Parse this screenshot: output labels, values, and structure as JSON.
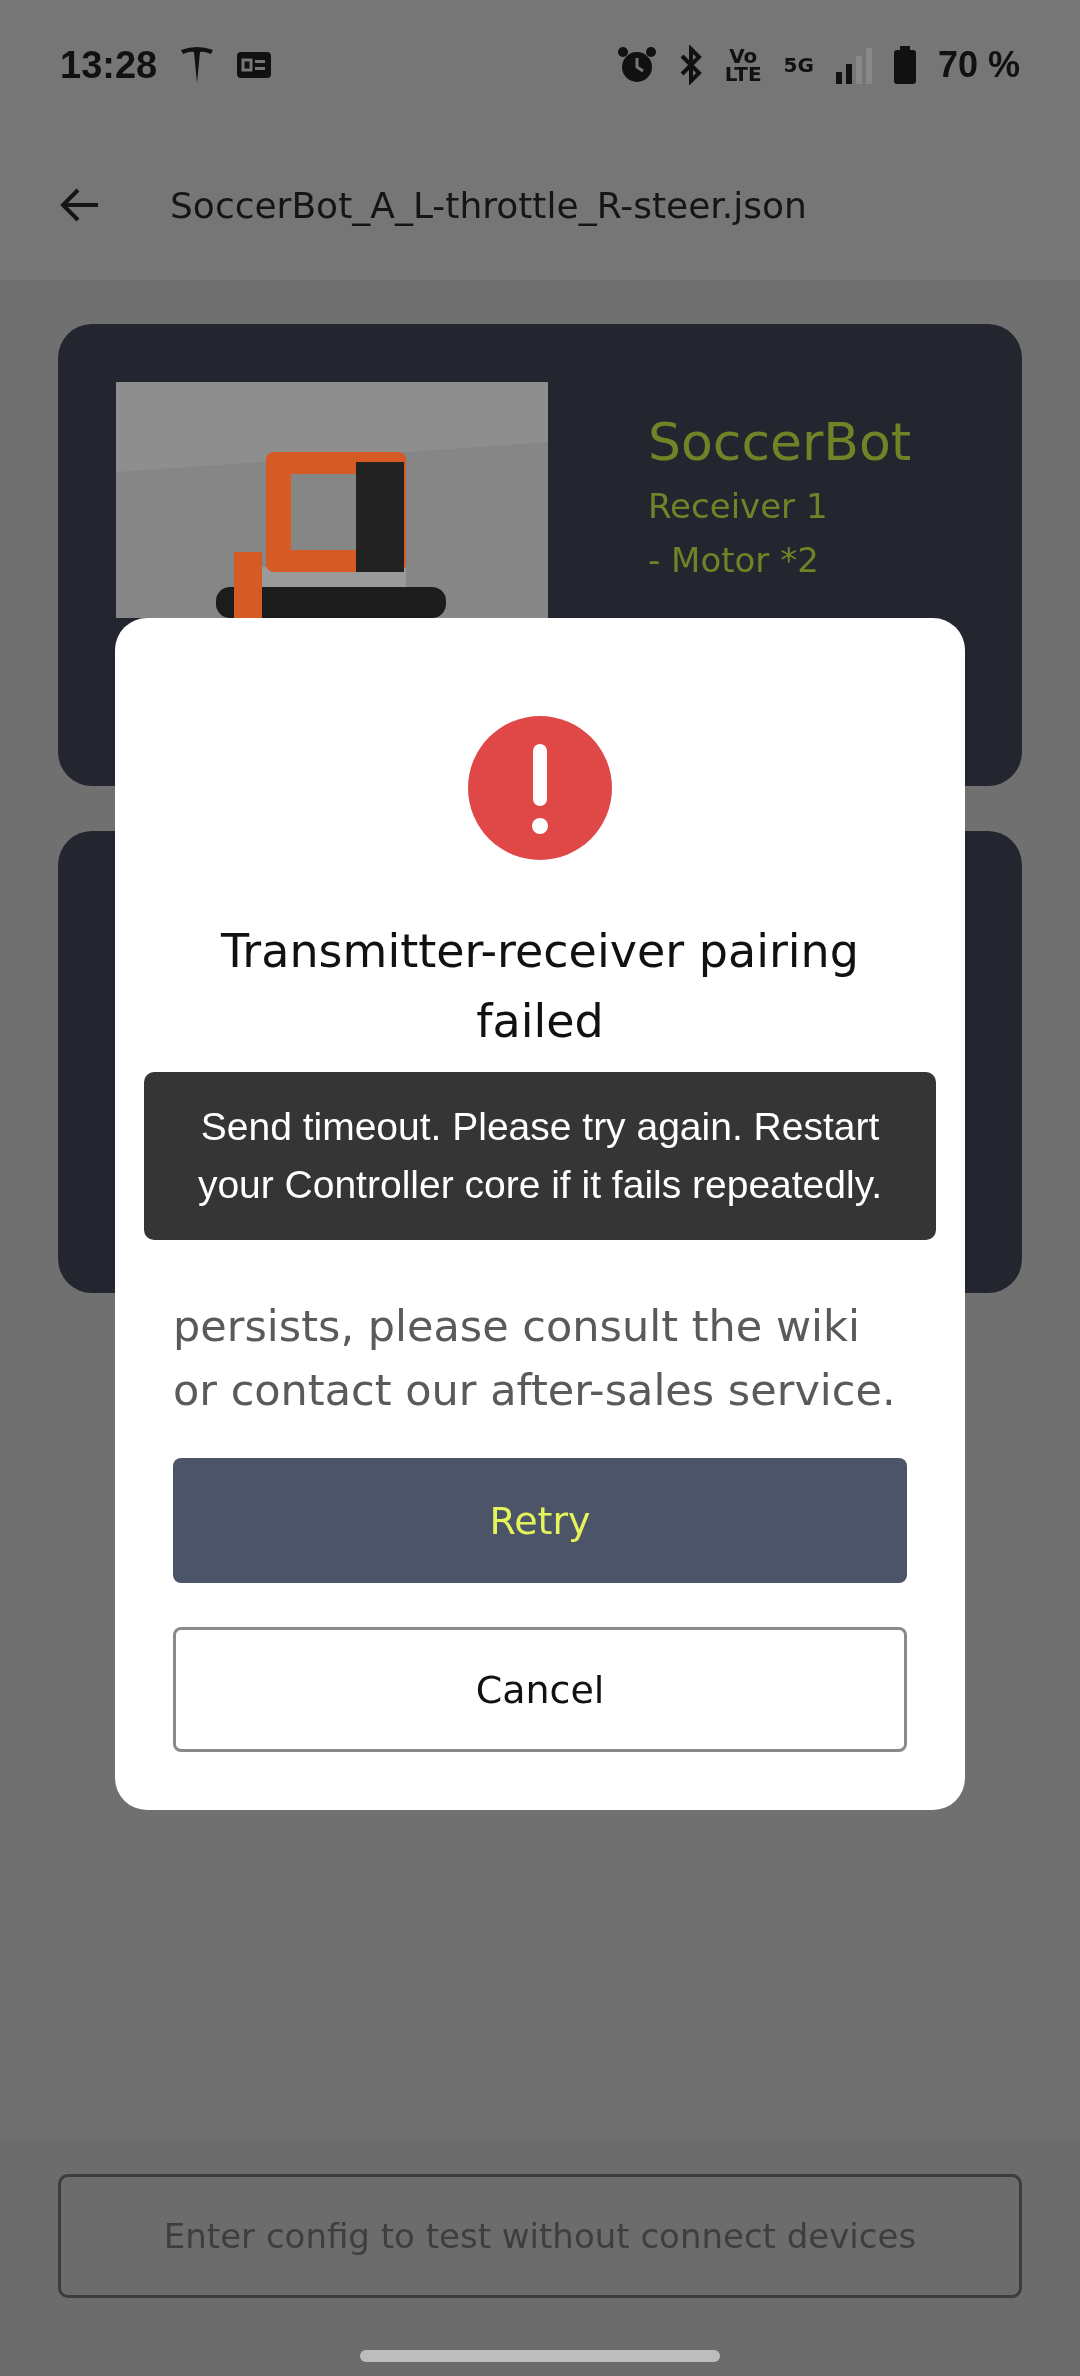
{
  "status_bar": {
    "time": "13:28",
    "volte_top": "Vo",
    "volte_bottom": "LTE",
    "network": "5G",
    "battery": "70 %"
  },
  "app_bar": {
    "title": "SoccerBot_A_L-throttle_R-steer.json"
  },
  "cards": [
    {
      "kind": "robot",
      "name": "SoccerBot",
      "receiver": "Receiver 1",
      "parts": [
        "- Motor *2"
      ]
    },
    {
      "kind": "empty"
    }
  ],
  "dialog": {
    "title": "Transmitter-receiver pairing failed",
    "message": "persists, please consult the wiki or contact our after-sales service.",
    "buttons": [
      {
        "label": "Retry",
        "kind": "primary"
      },
      {
        "label": "Cancel",
        "kind": "secondary"
      }
    ]
  },
  "toast": {
    "text": "Send timeout. Please try again. Restart your Controller core if it fails repeatedly."
  },
  "bottom": {
    "placeholder": "Enter config to test without connect devices"
  }
}
